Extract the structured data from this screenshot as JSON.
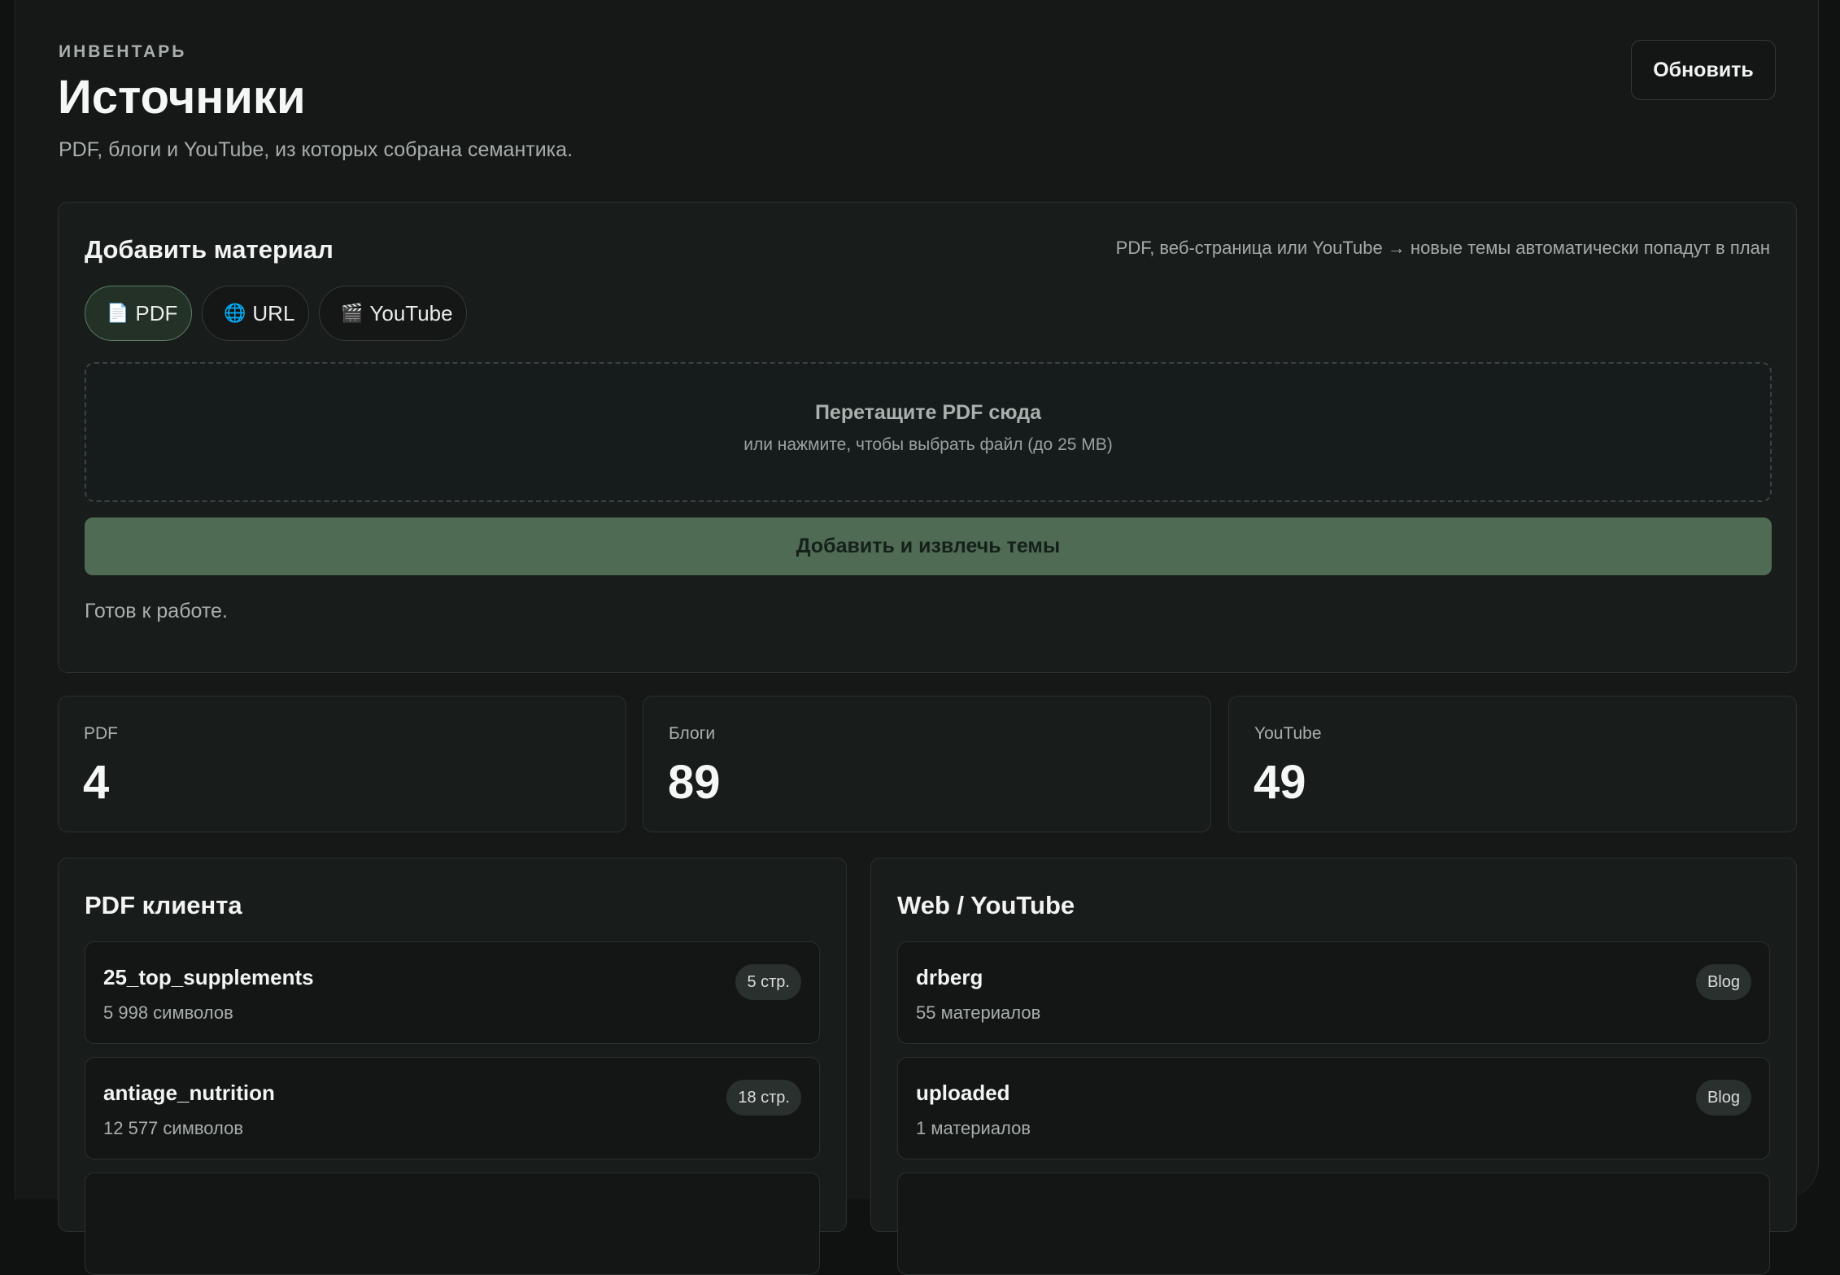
{
  "header": {
    "eyebrow": "ИНВЕНТАРЬ",
    "title": "Источники",
    "subtitle": "PDF, блоги и YouTube, из которых собрана семантика.",
    "refresh_label": "Обновить"
  },
  "add_material": {
    "title": "Добавить материал",
    "hint": "PDF, веб-страница или YouTube → новые темы автоматически попадут в план",
    "tabs": [
      {
        "icon": "document-icon",
        "glyph": "📄",
        "label": "PDF",
        "active": true
      },
      {
        "icon": "globe-icon",
        "glyph": "🌐",
        "label": "URL",
        "active": false
      },
      {
        "icon": "clapperboard-icon",
        "glyph": "🎬",
        "label": "YouTube",
        "active": false
      }
    ],
    "dropzone": {
      "title": "Перетащите PDF сюда",
      "subtitle": "или нажмите, чтобы выбрать файл (до 25 MB)"
    },
    "submit_label": "Добавить и извлечь темы",
    "status": "Готов к работе."
  },
  "stats": [
    {
      "label": "PDF",
      "value": "4"
    },
    {
      "label": "Блоги",
      "value": "89"
    },
    {
      "label": "YouTube",
      "value": "49"
    }
  ],
  "pdf_list": {
    "title": "PDF клиента",
    "items": [
      {
        "name": "25_top_supplements",
        "meta": "5 998 символов",
        "badge": "5 стр."
      },
      {
        "name": "antiage_nutrition",
        "meta": "12 577 символов",
        "badge": "18 стр."
      },
      {
        "name": "",
        "meta": "",
        "badge": ""
      }
    ]
  },
  "web_list": {
    "title": "Web / YouTube",
    "items": [
      {
        "name": "drberg",
        "meta": "55 материалов",
        "badge": "Blog"
      },
      {
        "name": "uploaded",
        "meta": "1 материалов",
        "badge": "Blog"
      },
      {
        "name": "",
        "meta": "",
        "badge": ""
      }
    ]
  },
  "colors": {
    "background": "#151817",
    "card": "#181c1b",
    "accent_green": "#4f6b54",
    "active_tab_border": "#5c7d63"
  }
}
